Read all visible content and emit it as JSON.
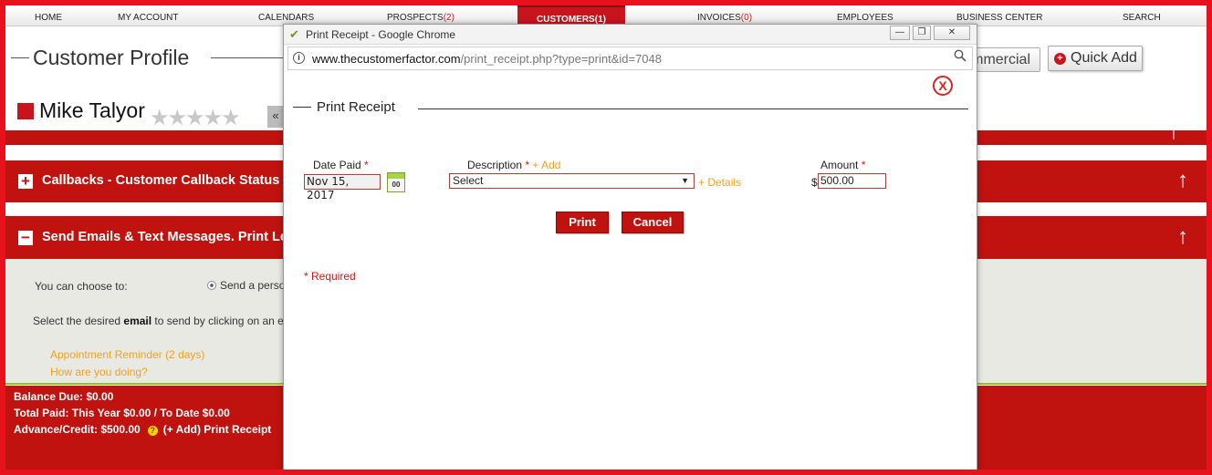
{
  "nav": {
    "items": [
      {
        "label": "HOME",
        "count": ""
      },
      {
        "label": "MY ACCOUNT",
        "count": ""
      },
      {
        "label": "CALENDARS",
        "count": ""
      },
      {
        "label": "PROSPECTS",
        "count": "(2)"
      },
      {
        "label": "CUSTOMERS",
        "count": "(1)"
      },
      {
        "label": "INVOICES",
        "count": "(0)"
      },
      {
        "label": "EMPLOYEES",
        "count": ""
      },
      {
        "label": "BUSINESS CENTER",
        "count": ""
      },
      {
        "label": "SEARCH",
        "count": ""
      }
    ],
    "active": "CUSTOMERS"
  },
  "page": {
    "title": "Customer Profile",
    "commercial_button": "mmercial",
    "quick_add_button": "Quick Add",
    "quick_add_icon": "+",
    "customer_name": "Mike Talyor",
    "stars": "★★★★★",
    "collapse_label": "«"
  },
  "sections": {
    "callbacks": {
      "sign": "+",
      "title": "Callbacks - Customer Callback Status & Inf",
      "arrow": "↑"
    },
    "emails": {
      "sign": "−",
      "title": "Send Emails & Text Messages. Print Letters",
      "arrow": "↑"
    },
    "top_arrow": "↑"
  },
  "emails_panel": {
    "choose_label": "You can choose to:",
    "radio_label": "Send a perso",
    "select_prefix": "Select the desired ",
    "select_bold": "email",
    "select_suffix": " to send by clicking on an e",
    "links": [
      "Appointment Reminder (2 days)",
      "How are you doing?"
    ]
  },
  "balance": {
    "balance_due": "Balance Due: $0.00",
    "total_paid": "Total Paid: This Year $0.00 / To Date $0.00",
    "advance_credit": "Advance/Credit: $500.00",
    "help_icon": "?",
    "print_receipt_link": "(+ Add) Print Receipt"
  },
  "popup": {
    "window_title": "Print Receipt - Google Chrome",
    "minimize": "—",
    "restore": "❐",
    "close": "✕",
    "url_host": "www.thecustomerfactor.com",
    "url_path": "/print_receipt.php?type=print&id=7048",
    "info_icon": "i",
    "zoom_icon": "🔍",
    "close_x": "X",
    "heading": "Print Receipt",
    "form": {
      "date_label": "Date Paid",
      "date_value": "Nov 15, 2017",
      "calendar_day": "00",
      "description_label": "Description",
      "add_link": "+ Add",
      "description_value": "Select",
      "details_link": "+ Details",
      "amount_label": "Amount",
      "currency": "$",
      "amount_value": "500.00",
      "required_mark": "*"
    },
    "buttons": {
      "print": "Print",
      "cancel": "Cancel"
    },
    "required_note": "* Required"
  },
  "colors": {
    "brand_red": "#c0120f",
    "border_red": "#e8121e",
    "link_orange": "#f0a020",
    "accent_green": "#95c11f"
  }
}
